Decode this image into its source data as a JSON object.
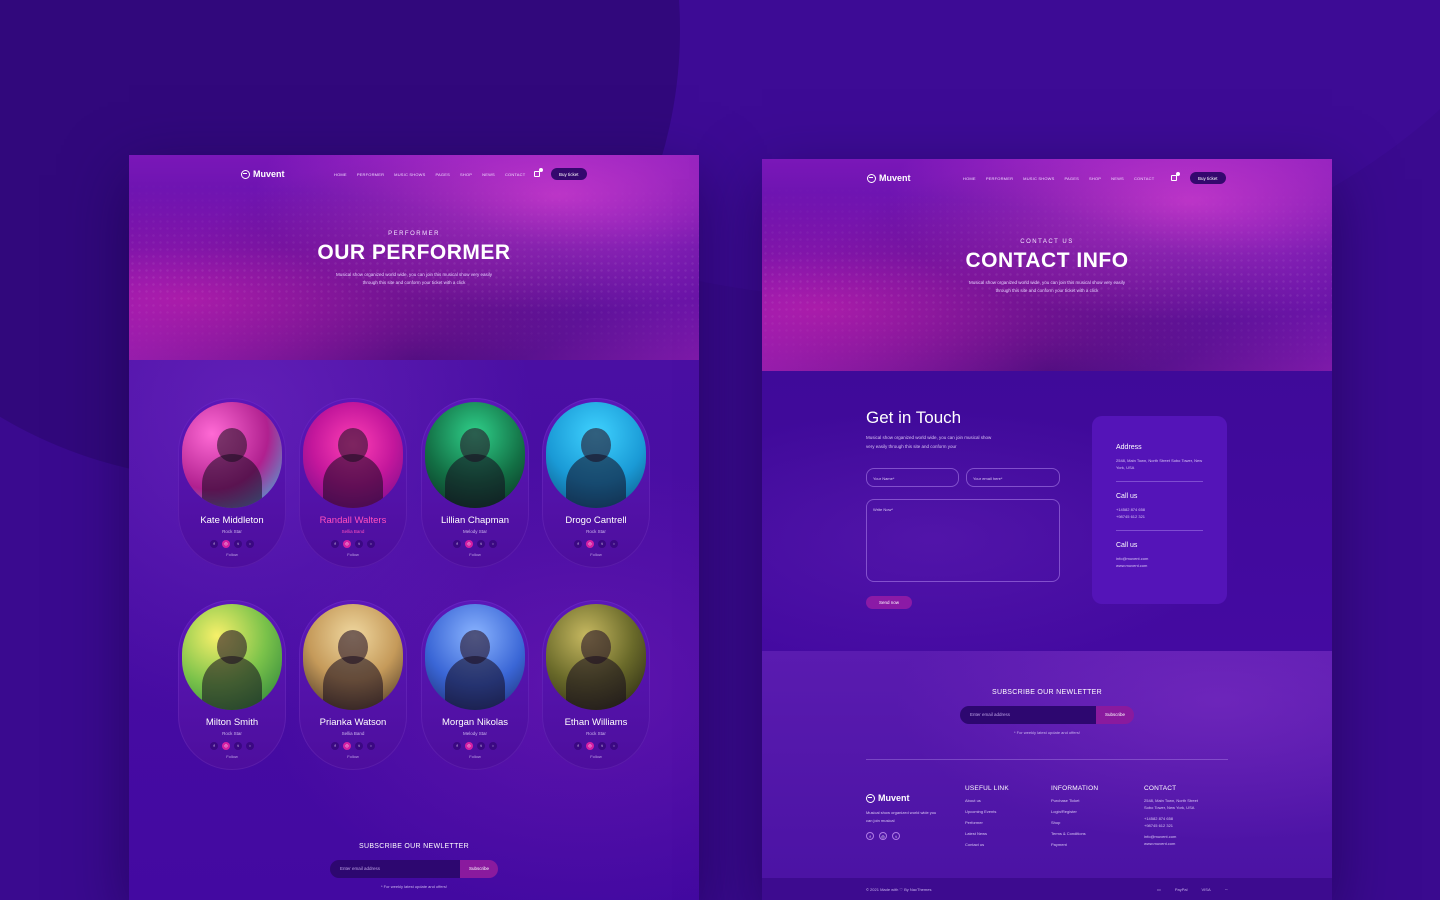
{
  "brand": {
    "name": "Muvent"
  },
  "nav": {
    "items": [
      "HOME",
      "PERFORMER",
      "MUSIC SHOWS",
      "PAGES",
      "SHOP",
      "NEWS",
      "CONTACT"
    ],
    "cart_count": "0",
    "buy_ticket": "Buy ticket"
  },
  "performer_page": {
    "eyebrow": "PERFORMER",
    "title": "OUR PERFORMER",
    "description": "Musical show organized world wide, you can join this musical show very easily through this site and conform your ticket with a click",
    "performers": [
      {
        "name": "Kate Middleton",
        "role": "Rock Star",
        "active": false,
        "color": "#d23aa8"
      },
      {
        "name": "Randall Walters",
        "role": "Sellia Band",
        "active": true,
        "color": "#e23dcf"
      },
      {
        "name": "Lillian Chapman",
        "role": "Melody Star",
        "active": false,
        "color": "#1e7a4a"
      },
      {
        "name": "Drogo Cantrell",
        "role": "Rock Star",
        "active": false,
        "color": "#1fb6e6"
      },
      {
        "name": "Milton Smith",
        "role": "Rock Star",
        "active": false,
        "color": "#7ac24a"
      },
      {
        "name": "Prianka Watson",
        "role": "Sellia Band",
        "active": false,
        "color": "#c59a5a"
      },
      {
        "name": "Morgan Nikolas",
        "role": "Melody Star",
        "active": false,
        "color": "#3a66d6"
      },
      {
        "name": "Ethan Williams",
        "role": "Rock Star",
        "active": false,
        "color": "#6a6a2a"
      }
    ],
    "follow_label": "Follow"
  },
  "newsletter": {
    "title": "SUBSCRIBE OUR NEWLETTER",
    "placeholder": "Enter email address",
    "button": "Subscribe",
    "note": "* For weekly latest update and offers!"
  },
  "contact_page": {
    "eyebrow": "CONTACT US",
    "title": "CONTACT INFO",
    "description": "Musical show organized world wide, you can join this musical show very easily through this site and conform your ticket with a click",
    "get_in_touch": "Get in Touch",
    "form_description": "Musical show organized world wide, you can join musical show very easily through this site and conform your",
    "name_placeholder": "Your Name*",
    "email_placeholder": "Your email here*",
    "message_placeholder": "Write Now*",
    "send_button": "Send now",
    "info": {
      "address_title": "Address",
      "address": "2548, Main Town, North Street Sobo Tower, New York, USA",
      "call_title": "Call us",
      "phones": "+14582 874 658\n+98745 612 321",
      "email_title": "Call us",
      "emails": "info@muvent.com\nwww.muvent.com"
    }
  },
  "footer": {
    "description": "Musical show organized world wide you can join musical",
    "useful_title": "USEFUL LINK",
    "useful_links": [
      "About us",
      "Upcoming Events",
      "Performer",
      "Latest News",
      "Contact us"
    ],
    "info_title": "INFORMATION",
    "info_links": [
      "Purchase Ticket",
      "Login/Register",
      "Shop",
      "Terms & Conditions",
      "Payment"
    ],
    "contact_title": "CONTACT",
    "contact_lines": [
      "2548, Main Town, North Street",
      "Sobo Tower, New York, USA",
      "+14582 874 658",
      "+98745 612 321",
      "info@muvent.com",
      "www.muvent.com"
    ],
    "copyright": "© 2021 Made with ♡ By NacThemes",
    "payments": [
      "▭",
      "PayPal",
      "VISA",
      "∽"
    ]
  }
}
